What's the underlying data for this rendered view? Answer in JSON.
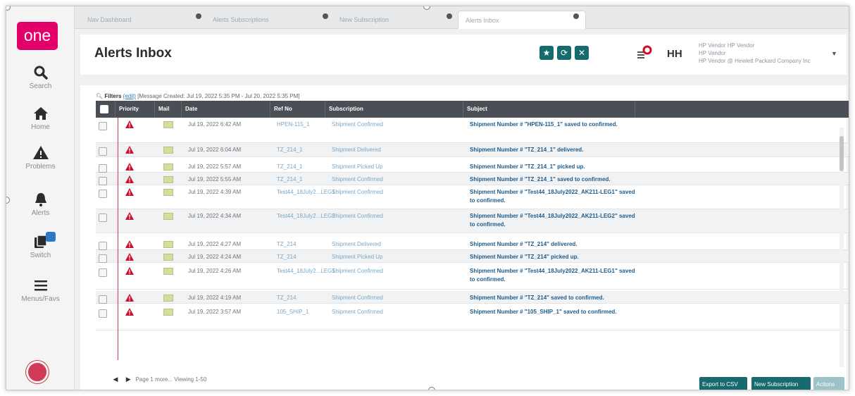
{
  "sidebar": {
    "logo": "one",
    "items": [
      {
        "label": "Search",
        "icon": "search-icon"
      },
      {
        "label": "Home",
        "icon": "home-icon"
      },
      {
        "label": "Problems",
        "icon": "warning-icon"
      },
      {
        "label": "Alerts",
        "icon": "bell-icon"
      },
      {
        "label": "Switch",
        "icon": "switch-icon"
      },
      {
        "label": "Menus/Favs",
        "icon": "menu-icon"
      }
    ]
  },
  "tabs": [
    {
      "label": "Nav Dashboard"
    },
    {
      "label": "Alerts Subscriptions"
    },
    {
      "label": "New Subscription"
    },
    {
      "label": "Alerts Inbox"
    }
  ],
  "header": {
    "title": "Alerts Inbox",
    "user_initials": "HH",
    "user_name_line1": "HP Vendor HP Vendor",
    "user_name_line2": "HP Vendor",
    "user_name_line3": "HP Vendor @ Hewlett Packard Company Inc"
  },
  "filters": {
    "label": "Filters",
    "edit": "(edit)",
    "text": "[Message Created: Jul 19, 2022 5:35 PM - Jul 20, 2022 5:35 PM]"
  },
  "grid": {
    "columns": [
      "Priority",
      "Mail",
      "Date",
      "Ref No",
      "Subscription",
      "Subject"
    ],
    "rows": [
      {
        "date": "Jul 19, 2022 6:42 AM",
        "ref": "HPEN-115_1",
        "subscription": "Shipment Confirmed",
        "subject": "Shipment Number # \"HPEN-115_1\" saved to confirmed."
      },
      {
        "date": "Jul 19, 2022 6:04 AM",
        "ref": "TZ_214_1",
        "subscription": "Shipment Delivered",
        "subject": "Shipment Number # \"TZ_214_1\" delivered."
      },
      {
        "date": "Jul 19, 2022 5:57 AM",
        "ref": "TZ_214_1",
        "subscription": "Shipment Picked Up",
        "subject": "Shipment Number # \"TZ_214_1\" picked up."
      },
      {
        "date": "Jul 19, 2022 5:55 AM",
        "ref": "TZ_214_1",
        "subscription": "Shipment Confirmed",
        "subject": "Shipment Number # \"TZ_214_1\" saved to confirmed."
      },
      {
        "date": "Jul 19, 2022 4:39 AM",
        "ref": "Test44_18July2...LEG1",
        "subscription": "Shipment Confirmed",
        "subject": "Shipment Number # \"Test44_18July2022_AK211-LEG1\" saved to confirmed."
      },
      {
        "date": "Jul 19, 2022 4:34 AM",
        "ref": "Test44_18July2...LEG2",
        "subscription": "Shipment Confirmed",
        "subject": "Shipment Number # \"Test44_18July2022_AK211-LEG2\" saved to confirmed."
      },
      {
        "date": "Jul 19, 2022 4:27 AM",
        "ref": "TZ_214",
        "subscription": "Shipment Delivered",
        "subject": "Shipment Number # \"TZ_214\" delivered."
      },
      {
        "date": "Jul 19, 2022 4:24 AM",
        "ref": "TZ_214",
        "subscription": "Shipment Picked Up",
        "subject": "Shipment Number # \"TZ_214\" picked up."
      },
      {
        "date": "Jul 19, 2022 4:26 AM",
        "ref": "Test44_18July2...LEG1",
        "subscription": "Shipment Confirmed",
        "subject": "Shipment Number # \"Test44_18July2022_AK211-LEG1\" saved to confirmed."
      },
      {
        "date": "Jul 19, 2022 4:19 AM",
        "ref": "TZ_214",
        "subscription": "Shipment Confirmed",
        "subject": "Shipment Number # \"TZ_214\" saved to confirmed."
      },
      {
        "date": "Jul 19, 2022 3:57 AM",
        "ref": "105_SHIP_1",
        "subscription": "Shipment Confirmed",
        "subject": "Shipment Number # \"105_SHIP_1\" saved to confirmed."
      }
    ]
  },
  "footer": {
    "page_label": "Page",
    "page_number": "1",
    "page_more": "more...",
    "viewing": "Viewing 1-50",
    "export_csv": "Export to CSV",
    "new_subscription": "New Subscription",
    "actions": "Actions"
  },
  "colors": {
    "accent": "#176a6e",
    "logo": "#e3006b",
    "priority": "#c8102e",
    "header_bg": "#4a4f55"
  }
}
